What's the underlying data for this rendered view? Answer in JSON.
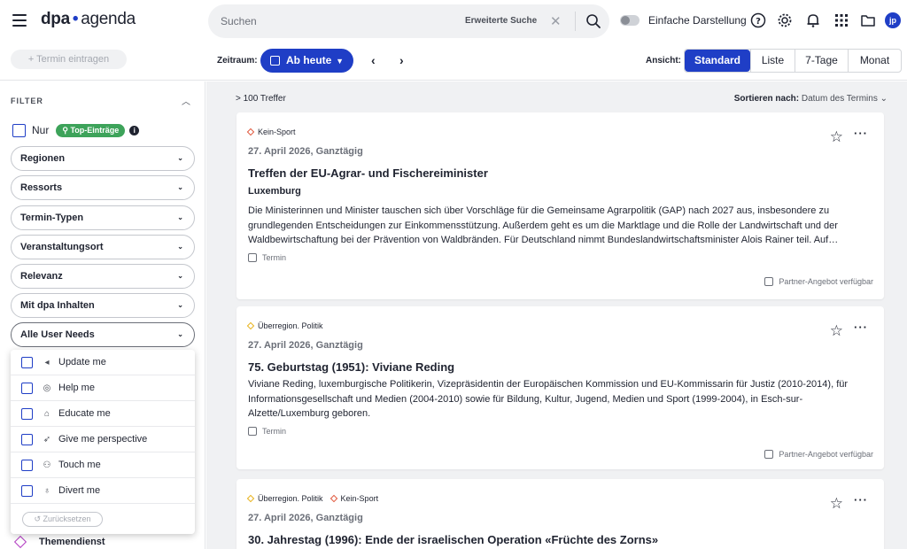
{
  "app": {
    "logo_dpa": "dpa",
    "logo_sep": "•",
    "logo_agenda": "agenda"
  },
  "search": {
    "placeholder": "Suchen",
    "advanced_label": "Erweiterte Suche"
  },
  "topbar": {
    "simple_view_label": "Einfache Darstellung",
    "avatar_initials": "jp",
    "icons": [
      "help-icon",
      "settings-icon",
      "bell-icon",
      "apps-grid-icon",
      "folder-icon"
    ]
  },
  "toolbar": {
    "add_label": "+ Termin eintragen",
    "zeitraum_label": "Zeitraum:",
    "zeitraum_value": "Ab heute",
    "prev": "‹",
    "next": "›",
    "ansicht_label": "Ansicht:",
    "views": [
      {
        "label": "Standard",
        "active": true
      },
      {
        "label": "Liste",
        "active": false
      },
      {
        "label": "7-Tage",
        "active": false
      },
      {
        "label": "Monat",
        "active": false
      }
    ]
  },
  "sidebar": {
    "filter_title": "FILTER",
    "nur_label": "Nur",
    "top_badge": "Top-Einträge",
    "info": "i",
    "filters": [
      "Regionen",
      "Ressorts",
      "Termin-Typen",
      "Veranstaltungsort",
      "Relevanz",
      "Mit dpa Inhalten",
      "Alle User Needs"
    ],
    "user_needs": [
      {
        "label": "Update me",
        "icon": "megaphone-icon",
        "glyph": "◂"
      },
      {
        "label": "Help me",
        "icon": "lifebuoy-icon",
        "glyph": "◎"
      },
      {
        "label": "Educate me",
        "icon": "graduation-cap-icon",
        "glyph": "⌂"
      },
      {
        "label": "Give me perspective",
        "icon": "rocket-icon",
        "glyph": "➶"
      },
      {
        "label": "Touch me",
        "icon": "people-icon",
        "glyph": "⚇"
      },
      {
        "label": "Divert me",
        "icon": "balloon-icon",
        "glyph": "♁"
      }
    ],
    "reset_label": "Zurücksetzen",
    "themendienst_label": "Themendienst"
  },
  "main": {
    "hits": "> 100 Treffer",
    "sort_label": "Sortieren nach:",
    "sort_value": "Datum des Termins",
    "cards": [
      {
        "tags": [
          {
            "label": "Kein-Sport",
            "color": "#e0563b"
          }
        ],
        "date": "27. April 2026, Ganztägig",
        "title": "Treffen der EU-Agrar- und Fischereiminister",
        "subtitle": "Luxemburg",
        "description": "Die Ministerinnen und Minister tauschen sich über Vorschläge für die Gemeinsame Agrarpolitik (GAP) nach 2027 aus, insbesondere zu grundlegenden Entscheidungen zur Einkommensstützung. Außerdem geht es um die Marktlage und die Rolle der Landwirtschaft und der Waldbewirtschaftung bei der Prävention von Waldbränden. Für Deutschland nimmt Bundeslandwirtschaftsminister Alois Rainer teil. Auf…",
        "type": "Termin",
        "partner": "Partner-Angebot verfügbar"
      },
      {
        "tags": [
          {
            "label": "Überregion. Politik",
            "color": "#e8b21b"
          }
        ],
        "date": "27. April 2026, Ganztägig",
        "title": "75. Geburtstag (1951): Viviane Reding",
        "subtitle": "",
        "description": "Viviane Reding, luxemburgische Politikerin, Vizepräsidentin der Europäischen Kommission und EU-Kommissarin für Justiz (2010-2014), für Informationsgesellschaft und Medien (2004-2010) sowie für Bildung, Kultur, Jugend, Medien und Sport (1999-2004), in Esch-sur-Alzette/Luxemburg geboren.",
        "type": "Termin",
        "partner": "Partner-Angebot verfügbar"
      },
      {
        "tags": [
          {
            "label": "Überregion. Politik",
            "color": "#e8b21b"
          },
          {
            "label": "Kein-Sport",
            "color": "#e0563b"
          }
        ],
        "date": "27. April 2026, Ganztägig",
        "title": "30. Jahrestag (1996): Ende der israelischen Operation «Früchte des Zorns»",
        "subtitle": "",
        "description": "",
        "type": "",
        "partner": ""
      }
    ]
  },
  "colors": {
    "accent": "#1f3ec6",
    "top_badge": "#3da35a",
    "themendienst": "#b23cc2"
  }
}
